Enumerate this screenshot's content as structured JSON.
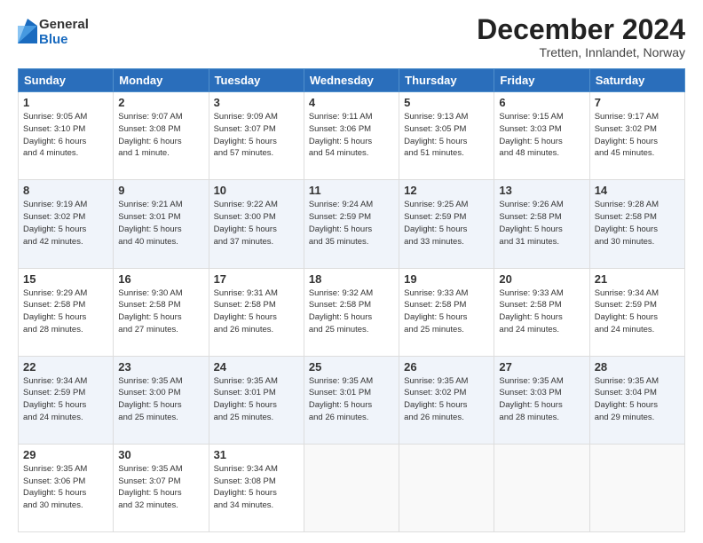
{
  "logo": {
    "general": "General",
    "blue": "Blue"
  },
  "title": "December 2024",
  "subtitle": "Tretten, Innlandet, Norway",
  "days_of_week": [
    "Sunday",
    "Monday",
    "Tuesday",
    "Wednesday",
    "Thursday",
    "Friday",
    "Saturday"
  ],
  "weeks": [
    [
      {
        "day": 1,
        "info": "Sunrise: 9:05 AM\nSunset: 3:10 PM\nDaylight: 6 hours\nand 4 minutes."
      },
      {
        "day": 2,
        "info": "Sunrise: 9:07 AM\nSunset: 3:08 PM\nDaylight: 6 hours\nand 1 minute."
      },
      {
        "day": 3,
        "info": "Sunrise: 9:09 AM\nSunset: 3:07 PM\nDaylight: 5 hours\nand 57 minutes."
      },
      {
        "day": 4,
        "info": "Sunrise: 9:11 AM\nSunset: 3:06 PM\nDaylight: 5 hours\nand 54 minutes."
      },
      {
        "day": 5,
        "info": "Sunrise: 9:13 AM\nSunset: 3:05 PM\nDaylight: 5 hours\nand 51 minutes."
      },
      {
        "day": 6,
        "info": "Sunrise: 9:15 AM\nSunset: 3:03 PM\nDaylight: 5 hours\nand 48 minutes."
      },
      {
        "day": 7,
        "info": "Sunrise: 9:17 AM\nSunset: 3:02 PM\nDaylight: 5 hours\nand 45 minutes."
      }
    ],
    [
      {
        "day": 8,
        "info": "Sunrise: 9:19 AM\nSunset: 3:02 PM\nDaylight: 5 hours\nand 42 minutes."
      },
      {
        "day": 9,
        "info": "Sunrise: 9:21 AM\nSunset: 3:01 PM\nDaylight: 5 hours\nand 40 minutes."
      },
      {
        "day": 10,
        "info": "Sunrise: 9:22 AM\nSunset: 3:00 PM\nDaylight: 5 hours\nand 37 minutes."
      },
      {
        "day": 11,
        "info": "Sunrise: 9:24 AM\nSunset: 2:59 PM\nDaylight: 5 hours\nand 35 minutes."
      },
      {
        "day": 12,
        "info": "Sunrise: 9:25 AM\nSunset: 2:59 PM\nDaylight: 5 hours\nand 33 minutes."
      },
      {
        "day": 13,
        "info": "Sunrise: 9:26 AM\nSunset: 2:58 PM\nDaylight: 5 hours\nand 31 minutes."
      },
      {
        "day": 14,
        "info": "Sunrise: 9:28 AM\nSunset: 2:58 PM\nDaylight: 5 hours\nand 30 minutes."
      }
    ],
    [
      {
        "day": 15,
        "info": "Sunrise: 9:29 AM\nSunset: 2:58 PM\nDaylight: 5 hours\nand 28 minutes."
      },
      {
        "day": 16,
        "info": "Sunrise: 9:30 AM\nSunset: 2:58 PM\nDaylight: 5 hours\nand 27 minutes."
      },
      {
        "day": 17,
        "info": "Sunrise: 9:31 AM\nSunset: 2:58 PM\nDaylight: 5 hours\nand 26 minutes."
      },
      {
        "day": 18,
        "info": "Sunrise: 9:32 AM\nSunset: 2:58 PM\nDaylight: 5 hours\nand 25 minutes."
      },
      {
        "day": 19,
        "info": "Sunrise: 9:33 AM\nSunset: 2:58 PM\nDaylight: 5 hours\nand 25 minutes."
      },
      {
        "day": 20,
        "info": "Sunrise: 9:33 AM\nSunset: 2:58 PM\nDaylight: 5 hours\nand 24 minutes."
      },
      {
        "day": 21,
        "info": "Sunrise: 9:34 AM\nSunset: 2:59 PM\nDaylight: 5 hours\nand 24 minutes."
      }
    ],
    [
      {
        "day": 22,
        "info": "Sunrise: 9:34 AM\nSunset: 2:59 PM\nDaylight: 5 hours\nand 24 minutes."
      },
      {
        "day": 23,
        "info": "Sunrise: 9:35 AM\nSunset: 3:00 PM\nDaylight: 5 hours\nand 25 minutes."
      },
      {
        "day": 24,
        "info": "Sunrise: 9:35 AM\nSunset: 3:01 PM\nDaylight: 5 hours\nand 25 minutes."
      },
      {
        "day": 25,
        "info": "Sunrise: 9:35 AM\nSunset: 3:01 PM\nDaylight: 5 hours\nand 26 minutes."
      },
      {
        "day": 26,
        "info": "Sunrise: 9:35 AM\nSunset: 3:02 PM\nDaylight: 5 hours\nand 26 minutes."
      },
      {
        "day": 27,
        "info": "Sunrise: 9:35 AM\nSunset: 3:03 PM\nDaylight: 5 hours\nand 28 minutes."
      },
      {
        "day": 28,
        "info": "Sunrise: 9:35 AM\nSunset: 3:04 PM\nDaylight: 5 hours\nand 29 minutes."
      }
    ],
    [
      {
        "day": 29,
        "info": "Sunrise: 9:35 AM\nSunset: 3:06 PM\nDaylight: 5 hours\nand 30 minutes."
      },
      {
        "day": 30,
        "info": "Sunrise: 9:35 AM\nSunset: 3:07 PM\nDaylight: 5 hours\nand 32 minutes."
      },
      {
        "day": 31,
        "info": "Sunrise: 9:34 AM\nSunset: 3:08 PM\nDaylight: 5 hours\nand 34 minutes."
      },
      null,
      null,
      null,
      null
    ]
  ]
}
